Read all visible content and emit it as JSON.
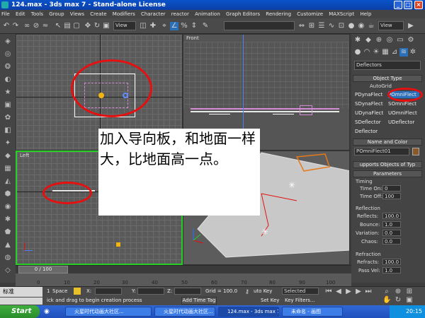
{
  "window": {
    "title": "124.max - 3ds max 7 - Stand-alone License",
    "min": "_",
    "max": "□",
    "close": "×"
  },
  "menu": [
    "File",
    "Edit",
    "Tools",
    "Group",
    "Views",
    "Create",
    "Modifiers",
    "Character",
    "reactor",
    "Animation",
    "Graph Editors",
    "Rendering",
    "Customize",
    "MAXScript",
    "Help"
  ],
  "toolbar": {
    "coord_system": "View",
    "view2": "View"
  },
  "viewports": {
    "top": {
      "label": ""
    },
    "front": {
      "label": "Front"
    },
    "left": {
      "label": "Left"
    },
    "perspective": {
      "label": ""
    }
  },
  "command_panel": {
    "category": "Deflectors",
    "object_type_title": "Object Type",
    "autogrid": "AutoGrid",
    "types": [
      [
        "PDynaFlect",
        "POmniFlect"
      ],
      [
        "SDynaFlect",
        "SOmniFlect"
      ],
      [
        "UDynaFlect",
        "UOmniFlect"
      ],
      [
        "SDeflector",
        "UDeflector"
      ],
      [
        "Deflector",
        ""
      ]
    ],
    "name_color_title": "Name and Color",
    "object_name": "POmniFlect01",
    "supports_title": "upports Objects of Typ",
    "parameters_title": "Parameters",
    "timing": {
      "label": "Timing",
      "time_on_label": "Time On:",
      "time_on": "0",
      "time_off_label": "Time Off:",
      "time_off": "100"
    },
    "reflection": {
      "label": "Reflection",
      "reflects_label": "Reflects:",
      "reflects": "100.0",
      "bounce_label": "Bounce:",
      "bounce": "1.0",
      "variation_label": "Variation:",
      "variation": "0.0",
      "chaos_label": "Chaos:",
      "chaos": "0.0"
    },
    "refraction": {
      "label": "Refraction",
      "refracts_label": "Refracts:",
      "refracts": "100.0",
      "passvel_label": "Pass Vel:",
      "passvel": "1.0"
    }
  },
  "timeline": {
    "frame": "0 / 100",
    "ticks": [
      "0",
      "10",
      "20",
      "30",
      "40",
      "50",
      "60",
      "70",
      "80",
      "90",
      "100"
    ]
  },
  "status": {
    "selected_count": "1",
    "space": "Space",
    "x_label": "X:",
    "y_label": "Y:",
    "z_label": "Z:",
    "grid": "Grid = 100.0",
    "autokey": "uto Key",
    "selected": "Selected",
    "setkey": "Set Key",
    "keyfilters": "Key Filters...",
    "prompt": "ick and drag to begin creation process",
    "add_time_tag": "Add Time Tag",
    "ime": "标准"
  },
  "caption": "加入导向板，和地面一样大，比地面高一点。",
  "taskbar": {
    "start": "Start",
    "tasks": [
      "火星时代动画大社区...",
      "火星时代动画大社区...",
      "124.max - 3ds max 7 ...",
      "未命名 - 画图"
    ],
    "clock": "20:15"
  },
  "colors": {
    "red_annotation": "#e51010",
    "active_viewport": "#26d026",
    "title_blue": "#0a53c9"
  }
}
